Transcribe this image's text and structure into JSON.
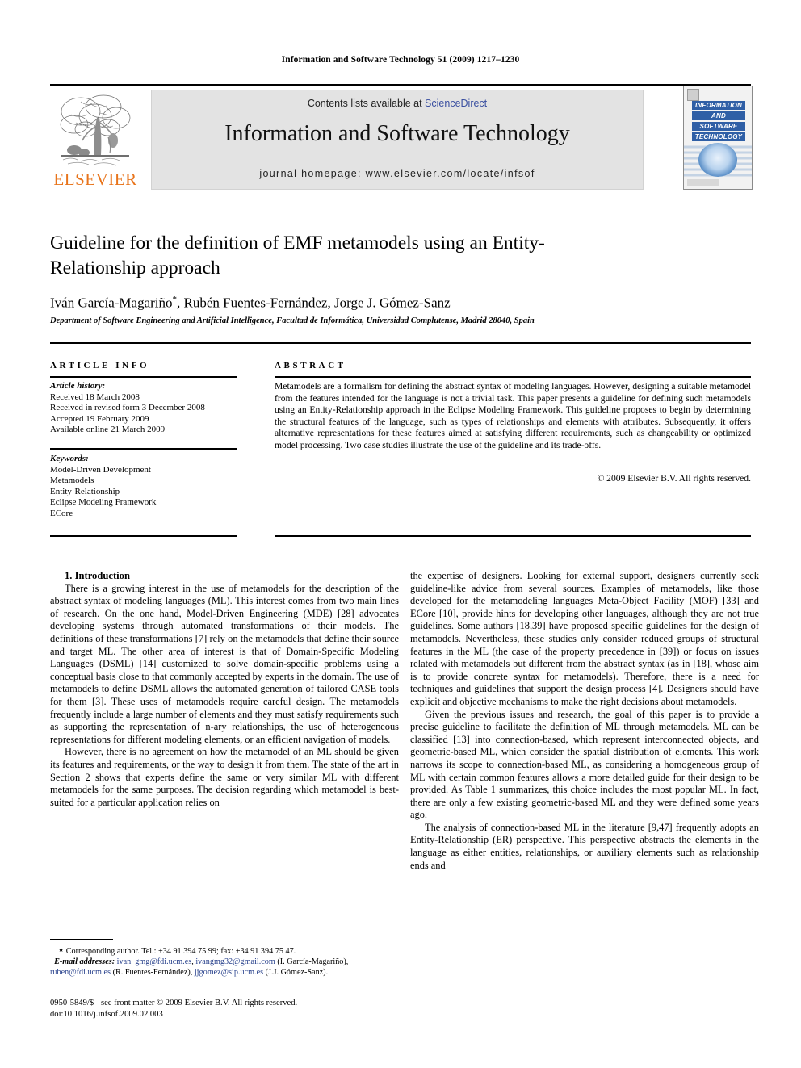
{
  "running_head": "Information and Software Technology 51 (2009) 1217–1230",
  "masthead": {
    "contents_prefix": "Contents lists available at ",
    "sciencedirect": "ScienceDirect",
    "journal_title": "Information and Software Technology",
    "homepage": "journal homepage: www.elsevier.com/locate/infsof",
    "publisher": "ELSEVIER",
    "publisher_color": "#E8741B",
    "link_color": "#3a4fa0",
    "cover_lines": [
      "INFORMATION",
      "AND",
      "SOFTWARE",
      "TECHNOLOGY"
    ]
  },
  "article": {
    "title": "Guideline for the definition of EMF metamodels using an Entity-Relationship approach",
    "authors": "Iván García-Magariño",
    "authors_rest": ", Rubén Fuentes-Fernández, Jorge J. Gómez-Sanz",
    "corresponding_mark": "*",
    "affiliation": "Department of Software Engineering and Artificial Intelligence, Facultad de Informática, Universidad Complutense, Madrid 28040, Spain"
  },
  "info": {
    "heading": "ARTICLE INFO",
    "history_label": "Article history:",
    "history": [
      "Received 18 March 2008",
      "Received in revised form 3 December 2008",
      "Accepted 19 February 2009",
      "Available online 21 March 2009"
    ],
    "keywords_label": "Keywords:",
    "keywords": [
      "Model-Driven Development",
      "Metamodels",
      "Entity-Relationship",
      "Eclipse Modeling Framework",
      "ECore"
    ]
  },
  "abstract": {
    "heading": "ABSTRACT",
    "text": "Metamodels are a formalism for defining the abstract syntax of modeling languages. However, designing a suitable metamodel from the features intended for the language is not a trivial task. This paper presents a guideline for defining such metamodels using an Entity-Relationship approach in the Eclipse Modeling Framework. This guideline proposes to begin by determining the structural features of the language, such as types of relationships and elements with attributes. Subsequently, it offers alternative representations for these features aimed at satisfying different requirements, such as changeability or optimized model processing. Two case studies illustrate the use of the guideline and its trade-offs.",
    "copyright": "© 2009 Elsevier B.V. All rights reserved."
  },
  "body": {
    "section_heading": "1. Introduction",
    "left_paragraphs": [
      "There is a growing interest in the use of metamodels for the description of the abstract syntax of modeling languages (ML). This interest comes from two main lines of research. On the one hand, Model-Driven Engineering (MDE) [28] advocates developing systems through automated transformations of their models. The definitions of these transformations [7] rely on the metamodels that define their source and target ML. The other area of interest is that of Domain-Specific Modeling Languages (DSML) [14] customized to solve domain-specific problems using a conceptual basis close to that commonly accepted by experts in the domain. The use of metamodels to define DSML allows the automated generation of tailored CASE tools for them [3]. These uses of metamodels require careful design. The metamodels frequently include a large number of elements and they must satisfy requirements such as supporting the representation of n-ary relationships, the use of heterogeneous representations for different modeling elements, or an efficient navigation of models.",
      "However, there is no agreement on how the metamodel of an ML should be given its features and requirements, or the way to design it from them. The state of the art in Section 2 shows that experts define the same or very similar ML with different metamodels for the same purposes. The decision regarding which metamodel is best-suited for a particular application relies on"
    ],
    "right_paragraphs": [
      "the expertise of designers. Looking for external support, designers currently seek guideline-like advice from several sources. Examples of metamodels, like those developed for the metamodeling languages Meta-Object Facility (MOF) [33] and ECore [10], provide hints for developing other languages, although they are not true guidelines. Some authors [18,39] have proposed specific guidelines for the design of metamodels. Nevertheless, these studies only consider reduced groups of structural features in the ML (the case of the property precedence in [39]) or focus on issues related with metamodels but different from the abstract syntax (as in [18], whose aim is to provide concrete syntax for metamodels). Therefore, there is a need for techniques and guidelines that support the design process [4]. Designers should have explicit and objective mechanisms to make the right decisions about metamodels.",
      "Given the previous issues and research, the goal of this paper is to provide a precise guideline to facilitate the definition of ML through metamodels. ML can be classified [13] into connection-based, which represent interconnected objects, and geometric-based ML, which consider the spatial distribution of elements. This work narrows its scope to connection-based ML, as considering a homogeneous group of ML with certain common features allows a more detailed guide for their design to be provided. As Table 1 summarizes, this choice includes the most popular ML. In fact, there are only a few existing geometric-based ML and they were defined some years ago.",
      "The analysis of connection-based ML in the literature [9,47] frequently adopts an Entity-Relationship (ER) perspective. This perspective abstracts the elements in the language as either entities, relationships, or auxiliary elements such as relationship ends and"
    ]
  },
  "footnote": {
    "corresponding": "Corresponding author. Tel.: +34 91 394 75 99; fax: +34 91 394 75 47.",
    "email_label": "E-mail addresses:",
    "emails": [
      {
        "address": "ivan_gmg@fdi.ucm.es",
        "owner": ""
      },
      {
        "address": "ivangmg32@gmail.com",
        "owner": "(I. García-Magariño)"
      },
      {
        "address": "ruben@fdi.ucm.es",
        "owner": "(R. Fuentes-Fernández)"
      },
      {
        "address": "jjgomez@sip.ucm.es",
        "owner": "(J.J. Gómez-Sanz)"
      }
    ],
    "link_color": "#28418c"
  },
  "imprint": {
    "line1": "0950-5849/$ - see front matter © 2009 Elsevier B.V. All rights reserved.",
    "line2": "doi:10.1016/j.infsof.2009.02.003"
  }
}
